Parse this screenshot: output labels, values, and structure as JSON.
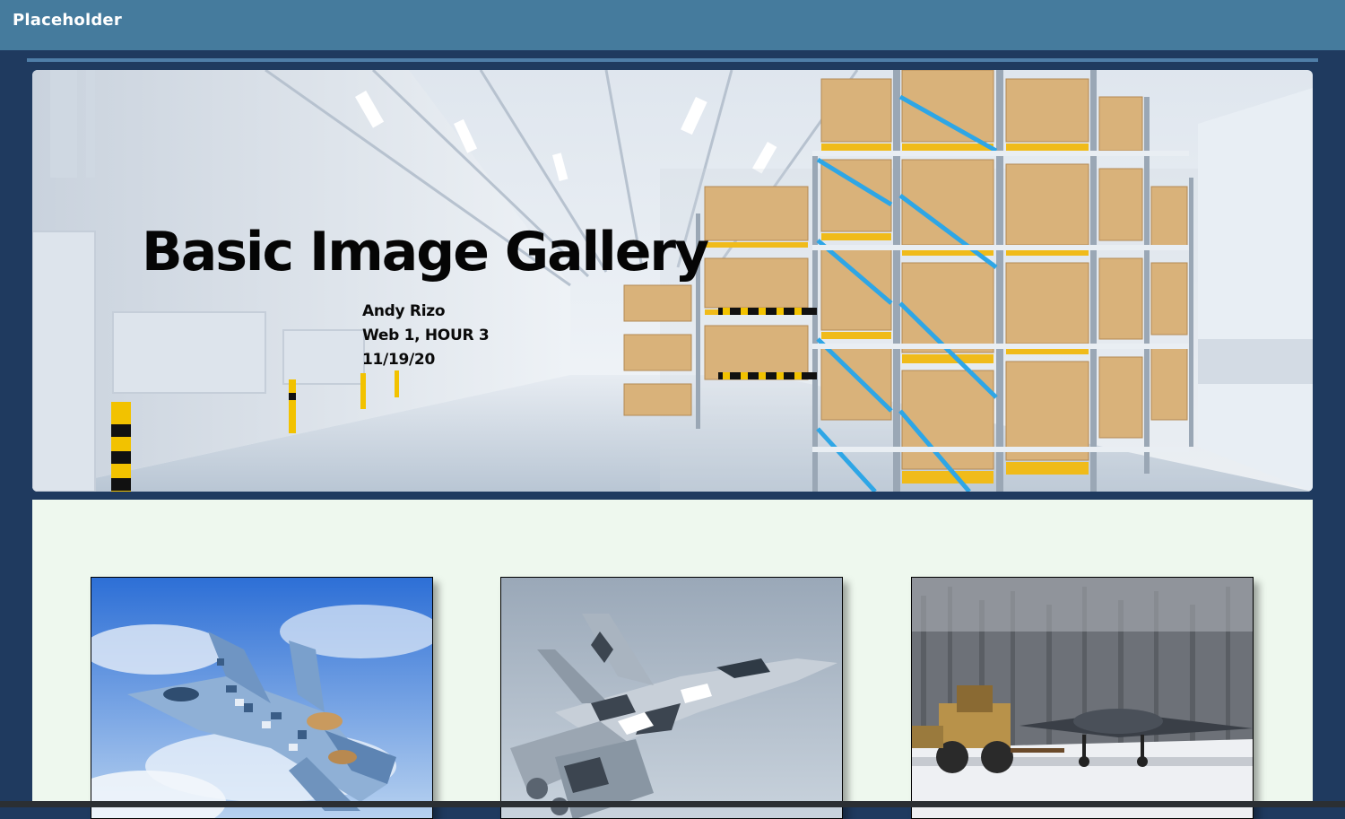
{
  "header": {
    "brand": "Placeholder"
  },
  "hero": {
    "title": "Basic Image Gallery",
    "author": "Andy Rizo",
    "course": "Web 1, HOUR 3",
    "date": "11/19/20",
    "image_subject": "warehouse-with-shelves"
  },
  "gallery": {
    "images": [
      {
        "subject": "stealth-fighter-jet-digital-camo"
      },
      {
        "subject": "fighter-jet-grey-camo"
      },
      {
        "subject": "drone-aircraft-on-snowy-runway"
      }
    ]
  },
  "colors": {
    "header_bg": "#457b9d",
    "page_bg": "#1f3a5f",
    "gallery_bg": "#eef8ee"
  }
}
